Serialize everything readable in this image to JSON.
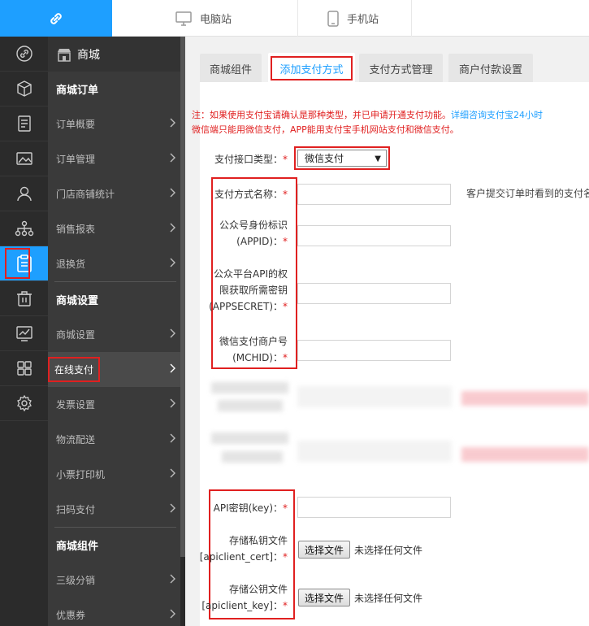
{
  "colors": {
    "accent": "#1e9fff",
    "highlight": "#e02020",
    "sidebar_dark": "#2b2b2b",
    "submenu": "#3a3a3a"
  },
  "topbar": {
    "logo_icon": "link-icon",
    "tabs": [
      {
        "label": "电脑站",
        "icon": "monitor-icon"
      },
      {
        "label": "手机站",
        "icon": "phone-icon"
      }
    ]
  },
  "rail": {
    "icons": [
      "link-icon",
      "cube-icon",
      "document-icon",
      "image-icon",
      "user-icon",
      "org-chart-icon",
      "clipboard-icon",
      "trash-icon",
      "chart-icon",
      "grid-icon",
      "gear-icon"
    ],
    "active": "clipboard-icon"
  },
  "submenu": {
    "title": "商城",
    "title_icon": "store-icon",
    "sections": [
      {
        "heading": "商城订单",
        "items": [
          "订单概要",
          "订单管理",
          "门店商铺统计",
          "销售报表",
          "退换货"
        ]
      },
      {
        "heading": "商城设置",
        "items": [
          "商城设置",
          "在线支付",
          "发票设置",
          "物流配送",
          "小票打印机",
          "扫码支付"
        ]
      },
      {
        "heading": "商城组件",
        "items": [
          "三级分销",
          "优惠券"
        ]
      }
    ],
    "active_item": "在线支付"
  },
  "main": {
    "tabs": [
      {
        "label": "商城组件"
      },
      {
        "label": "添加支付方式"
      },
      {
        "label": "支付方式管理"
      },
      {
        "label": "商户付款设置"
      }
    ],
    "active_tab": "添加支付方式",
    "note_red": "注：如果使用支付宝请确认是那种类型，并已申请开通支付功能。",
    "note_blue": "详细咨询支付宝24小时",
    "note_line2": "微信端只能用微信支付，APP能用支付宝手机网站支付和微信支付。",
    "form": {
      "type_label": "支付接口类型：",
      "type_value": "微信支付",
      "name_label": "支付方式名称：",
      "name_hint": "客户提交订单时看到的支付名",
      "appid_label_1": "公众号身份标识",
      "appid_label_2": "(APPID)：",
      "secret_label_1": "公众平台API的权",
      "secret_label_2": "限获取所需密钥",
      "secret_label_3": "(APPSECRET)：",
      "mchid_label_1": "微信支付商户号",
      "mchid_label_2": "(MCHID)：",
      "apikey_label": "API密钥(key)：",
      "cert_label_1": "存储私钥文件",
      "cert_label_2": "[apiclient_cert]：",
      "keyfile_label_1": "存储公钥文件",
      "keyfile_label_2": "[apiclient_key]：",
      "required_mark": "*",
      "file_button": "选择文件",
      "file_none": "未选择任何文件"
    }
  }
}
